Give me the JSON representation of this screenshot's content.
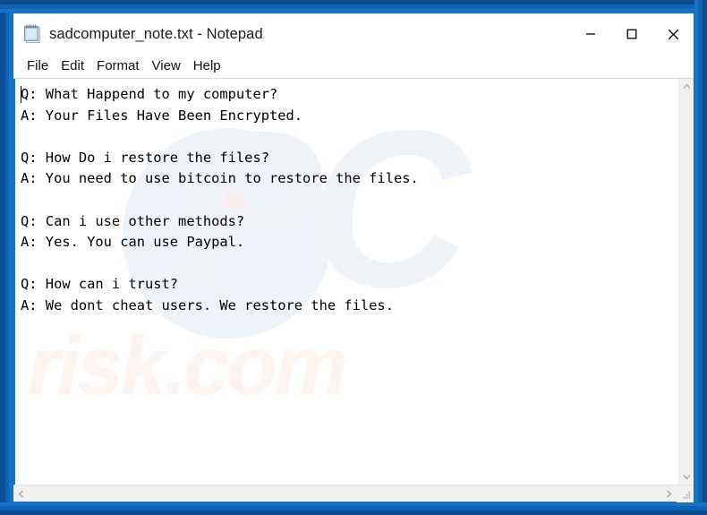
{
  "window": {
    "title": "sadcomputer_note.txt - Notepad",
    "icon": "notepad-icon",
    "filename": "sadcomputer_note.txt",
    "app_name": "Notepad",
    "frame_color": "#0e59a5",
    "accent_color": "#1273c8"
  },
  "controls": {
    "minimize_label": "Minimize",
    "maximize_label": "Maximize",
    "close_label": "Close"
  },
  "menu": {
    "items": [
      {
        "label": "File"
      },
      {
        "label": "Edit"
      },
      {
        "label": "Format"
      },
      {
        "label": "View"
      },
      {
        "label": "Help"
      }
    ]
  },
  "editor": {
    "content": "Q: What Happend to my computer?\nA: Your Files Have Been Encrypted.\n\nQ: How Do i restore the files?\nA: You need to use bitcoin to restore the files.\n\nQ: Can i use other methods?\nA: Yes. You can use Paypal.\n\nQ: How can i trust?\nA: We dont cheat users. We restore the files.",
    "lines": [
      "Q: What Happend to my computer?",
      "A: Your Files Have Been Encrypted.",
      "",
      "Q: How Do i restore the files?",
      "A: You need to use bitcoin to restore the files.",
      "",
      "Q: Can i use other methods?",
      "A: Yes. You can use Paypal.",
      "",
      "Q: How can i trust?",
      "A: We dont cheat users. We restore the files."
    ],
    "caret_visible": true
  },
  "watermark": {
    "logo_text": "PC",
    "domain_text": "risk.com"
  },
  "scrollbars": {
    "vertical": {
      "up_arrow": "chevron-up-icon",
      "down_arrow": "chevron-down-icon"
    },
    "horizontal": {
      "left_arrow": "chevron-left-icon",
      "right_arrow": "chevron-right-icon"
    },
    "resize_grip": "resize-grip-icon"
  }
}
